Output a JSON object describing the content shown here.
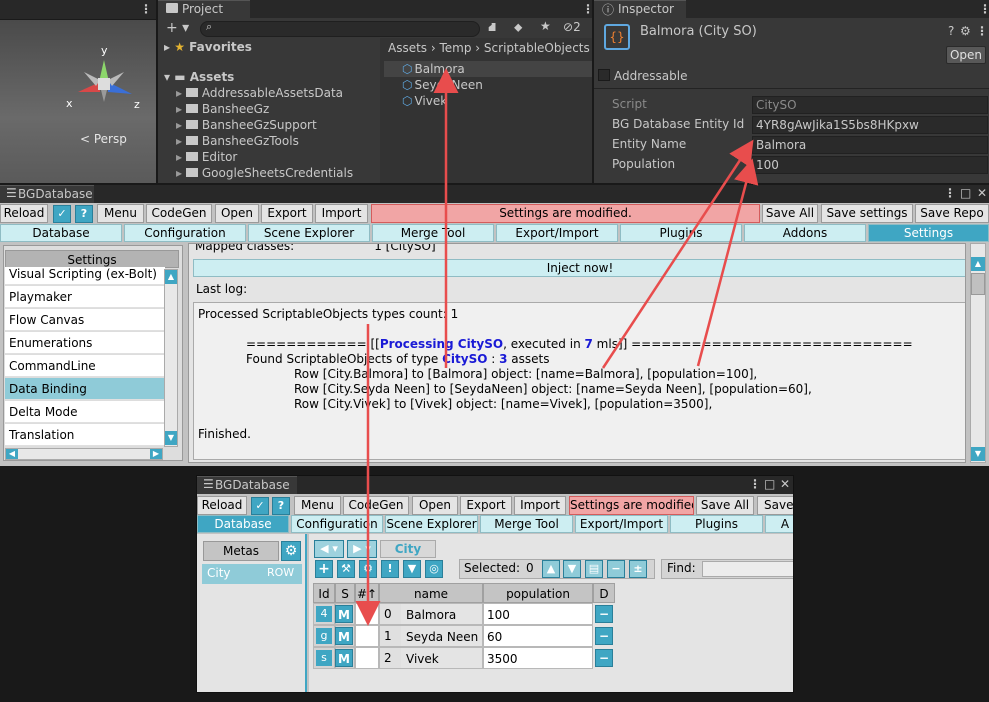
{
  "scene": {
    "axis_x": "x",
    "axis_y": "y",
    "axis_z": "z",
    "persp": "< Persp"
  },
  "project": {
    "title": "Project",
    "plus": "+ ▾",
    "favorites": "Favorites",
    "assets": "Assets",
    "eye_count": "2",
    "folders": [
      "AddressableAssetsData",
      "BansheeGz",
      "BansheeGzSupport",
      "BansheeGzTools",
      "Editor",
      "GoogleSheetsCredentials"
    ],
    "breadcrumb": [
      "Assets",
      "Temp",
      "ScriptableObjects"
    ],
    "files": [
      "Balmora",
      "SeydaNeen",
      "Vivek"
    ]
  },
  "inspector": {
    "title": "Inspector",
    "object_name": "Balmora (City SO)",
    "open_label": "Open",
    "addressable_label": "Addressable",
    "fields": [
      {
        "label": "Script",
        "value": "CitySO"
      },
      {
        "label": "BG Database Entity Id",
        "value": "4YR8gAwJika1S5bs8HKpxw"
      },
      {
        "label": "Entity Name",
        "value": "Balmora"
      },
      {
        "label": "Population",
        "value": "100"
      }
    ]
  },
  "db1": {
    "title": "BGDatabase",
    "reload": "Reload",
    "menu": "Menu",
    "codegen": "CodeGen",
    "open": "Open",
    "export": "Export",
    "import": "Import",
    "warning": "Settings are modified.",
    "save_all": "Save All",
    "save_settings": "Save settings",
    "save_repo": "Save Repo",
    "tabs": [
      "Database",
      "Configuration",
      "Scene Explorer",
      "Merge Tool",
      "Export/Import",
      "Plugins",
      "Addons",
      "Settings"
    ],
    "settings_header": "Settings",
    "settings_items": [
      "Visual Scripting (ex-Bolt)",
      "Playmaker",
      "Flow Canvas",
      "Enumerations",
      "CommandLine",
      "Data Binding",
      "Delta Mode",
      "Translation"
    ],
    "mapped_label": "Mapped classes:",
    "mapped_value": "1 [CitySO]",
    "inject_label": "Inject now!",
    "last_log_label": "Last log:",
    "log": {
      "l1": "Processed ScriptableObjects types count: 1",
      "l2a": "============ [[",
      "l2b": "Processing CitySO",
      "l2c": ", executed in ",
      "l2d": "7",
      "l2e": " mls]] ============================",
      "l3a": "Found ScriptableObjects of type ",
      "l3b": "CitySO",
      "l3c": " : ",
      "l3d": "3",
      "l3e": " assets",
      "r1": "Row [City.Balmora] to [Balmora] object: [name=Balmora], [population=100],",
      "r2": "Row [City.Seyda Neen] to [SeydaNeen] object: [name=Seyda Neen], [population=60],",
      "r3": "Row [City.Vivek] to [Vivek] object: [name=Vivek], [population=3500],",
      "fin": "Finished."
    }
  },
  "db2": {
    "title": "BGDatabase",
    "reload": "Reload",
    "menu": "Menu",
    "codegen": "CodeGen",
    "open": "Open",
    "export": "Export",
    "import": "Import",
    "warning": "Settings are modified.",
    "save_all": "Save All",
    "save_cut": "Save",
    "tabs": [
      "Database",
      "Configuration",
      "Scene Explorer",
      "Merge Tool",
      "Export/Import",
      "Plugins",
      "A"
    ],
    "metas_label": "Metas",
    "meta_name": "City",
    "meta_type": "ROW",
    "city_tab": "City",
    "selected_label": "Selected:",
    "selected_value": "0",
    "find_label": "Find:",
    "columns": [
      "Id",
      "S",
      "#↑",
      "name",
      "population",
      "D"
    ],
    "rows": [
      {
        "id": "4",
        "m": "M",
        "idx": "0",
        "name": "Balmora",
        "population": "100"
      },
      {
        "id": "g",
        "m": "M",
        "idx": "1",
        "name": "Seyda Neen",
        "population": "60"
      },
      {
        "id": "s",
        "m": "M",
        "idx": "2",
        "name": "Vivek",
        "population": "3500"
      }
    ]
  },
  "colors": {
    "accent": "#3fa6c3",
    "warning": "#f1a5a5",
    "arrow": "#e84d4d",
    "log_blue": "#1a1ad6"
  }
}
